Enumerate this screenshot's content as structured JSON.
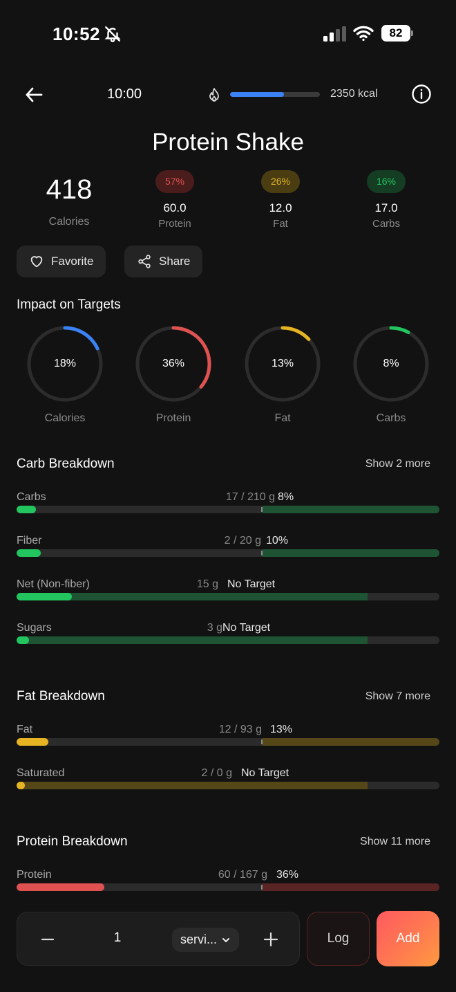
{
  "status_bar": {
    "time": "10:52",
    "battery": "82",
    "icons": [
      "bell-slash-icon",
      "signal-icon",
      "wifi-icon",
      "battery-icon"
    ]
  },
  "header": {
    "back_icon": "arrow-left-icon",
    "time": "10:00",
    "flame_icon": "flame-icon",
    "calorie_progress": 0.6,
    "kcal": "2350 kcal",
    "info_icon": "info-icon",
    "accent": "#3b82f6"
  },
  "food": {
    "title": "Protein Shake",
    "calories": "418",
    "calories_label": "Calories",
    "macros": [
      {
        "pct": "57%",
        "value": "60.0",
        "label": "Protein",
        "color": "#e05252"
      },
      {
        "pct": "26%",
        "value": "12.0",
        "label": "Fat",
        "color": "#e6b422"
      },
      {
        "pct": "16%",
        "value": "17.0",
        "label": "Carbs",
        "color": "#22c55e"
      }
    ]
  },
  "actions": {
    "favorite": "Favorite",
    "share": "Share"
  },
  "impact": {
    "title": "Impact on Targets",
    "rings": [
      {
        "pct": "18%",
        "label": "Calories",
        "value": 18,
        "color": "#3b82f6"
      },
      {
        "pct": "36%",
        "label": "Protein",
        "value": 36,
        "color": "#e05252"
      },
      {
        "pct": "13%",
        "label": "Fat",
        "value": 13,
        "color": "#e6b422"
      },
      {
        "pct": "8%",
        "label": "Carbs",
        "value": 8,
        "color": "#22c55e"
      }
    ]
  },
  "carb_breakdown": {
    "title": "Carb Breakdown",
    "show_more": "Show 2 more",
    "rows": [
      {
        "name": "Carbs",
        "amount": "17 / 210 g",
        "target": "8%"
      },
      {
        "name": "Fiber",
        "amount": "2 / 20 g",
        "target": "10%"
      },
      {
        "name": "Net (Non-fiber)",
        "amount": "15 g",
        "target": "No Target"
      },
      {
        "name": "Sugars",
        "amount": "3 g",
        "target": "No Target"
      }
    ]
  },
  "fat_breakdown": {
    "title": "Fat Breakdown",
    "show_more": "Show 7 more",
    "rows": [
      {
        "name": "Fat",
        "amount": "12 / 93 g",
        "target": "13%"
      },
      {
        "name": "Saturated",
        "amount": "2 / 0 g",
        "target": "No Target"
      }
    ]
  },
  "protein_breakdown": {
    "title": "Protein Breakdown",
    "show_more": "Show 11 more",
    "rows": [
      {
        "name": "Protein",
        "amount": "60 / 167 g",
        "target": "36%"
      }
    ]
  },
  "bottom_bar": {
    "quantity": "1",
    "unit": "servi...",
    "log": "Log",
    "add": "Add"
  }
}
